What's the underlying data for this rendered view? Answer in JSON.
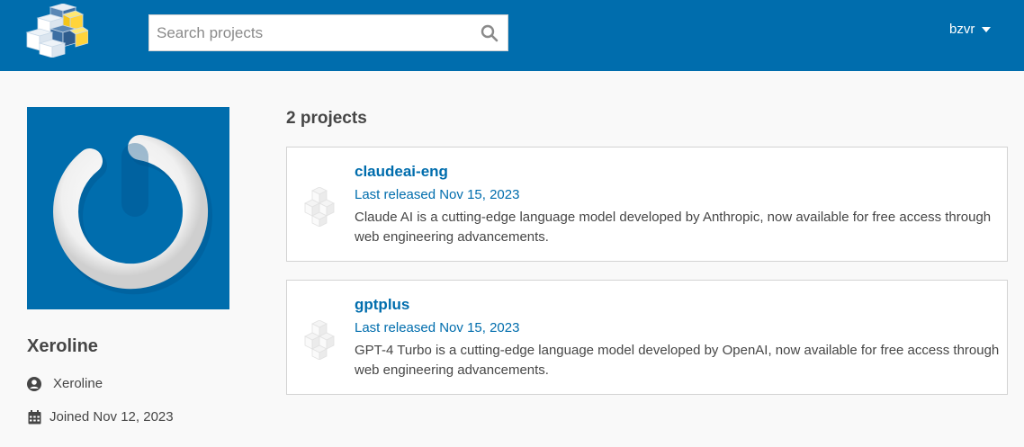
{
  "header": {
    "logo_icon": "pypi-cubes-logo",
    "search_placeholder": "Search projects",
    "search_icon": "search-icon",
    "user_name": "bzvr",
    "user_menu_icon": "caret-down-icon"
  },
  "profile": {
    "avatar_icon": "power-swirl-avatar",
    "name": "Xeroline",
    "username": "Xeroline",
    "joined": "Joined Nov 12, 2023"
  },
  "projects": {
    "count_label": "2 projects",
    "items": [
      {
        "name": "claudeai-eng",
        "released": "Last released Nov 15, 2023",
        "description": "Claude AI is a cutting-edge language model developed by Anthropic, now available for free access through web engineering advancements."
      },
      {
        "name": "gptplus",
        "released": "Last released Nov 15, 2023",
        "description": "GPT-4 Turbo is a cutting-edge language model developed by OpenAI, now available for free access through web engineering advancements."
      }
    ]
  },
  "colors": {
    "header_bg": "#006dad",
    "link": "#006dad",
    "text": "#464646",
    "page_bg": "#f9f9f9"
  }
}
